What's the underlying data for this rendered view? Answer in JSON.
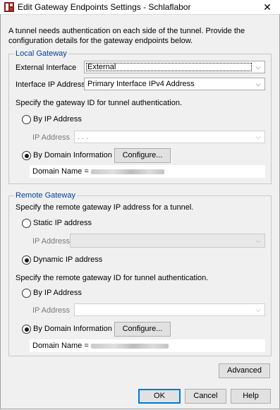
{
  "window": {
    "title": "Edit Gateway Endpoints Settings - Schlaflabor",
    "close_glyph": "✕"
  },
  "intro": "A tunnel needs authentication on each side of the tunnel. Provide the configuration details for the gateway endpoints below.",
  "local": {
    "legend": "Local Gateway",
    "external_interface_label": "External Interface",
    "external_interface_value": "External",
    "interface_ip_label": "Interface IP Address",
    "interface_ip_value": "Primary Interface IPv4 Address",
    "id_prompt": "Specify the gateway ID for tunnel authentication.",
    "by_ip_label": "By IP Address",
    "by_ip_checked": false,
    "ip_address_label": "IP Address",
    "ip_address_value": ".   .   .",
    "by_domain_label": "By Domain Information",
    "by_domain_checked": true,
    "configure_label": "Configure...",
    "domain_name_label": "Domain Name ="
  },
  "remote": {
    "legend": "Remote Gateway",
    "ip_prompt": "Specify the remote gateway IP address for a tunnel.",
    "static_ip_label": "Static IP address",
    "static_ip_checked": false,
    "ip_address_label": "IP Address",
    "dynamic_ip_label": "Dynamic IP address",
    "dynamic_ip_checked": true,
    "id_prompt": "Specify the remote gateway ID for tunnel authentication.",
    "by_ip_label": "By IP Address",
    "by_ip_checked": false,
    "id_ip_address_label": "IP Address",
    "by_domain_label": "By Domain Information",
    "by_domain_checked": true,
    "configure_label": "Configure...",
    "domain_name_label": "Domain Name ="
  },
  "buttons": {
    "advanced": "Advanced",
    "ok": "OK",
    "cancel": "Cancel",
    "help": "Help"
  },
  "colors": {
    "legend": "#0040a0",
    "accent": "#0078d7",
    "background": "#f0f0f0"
  }
}
